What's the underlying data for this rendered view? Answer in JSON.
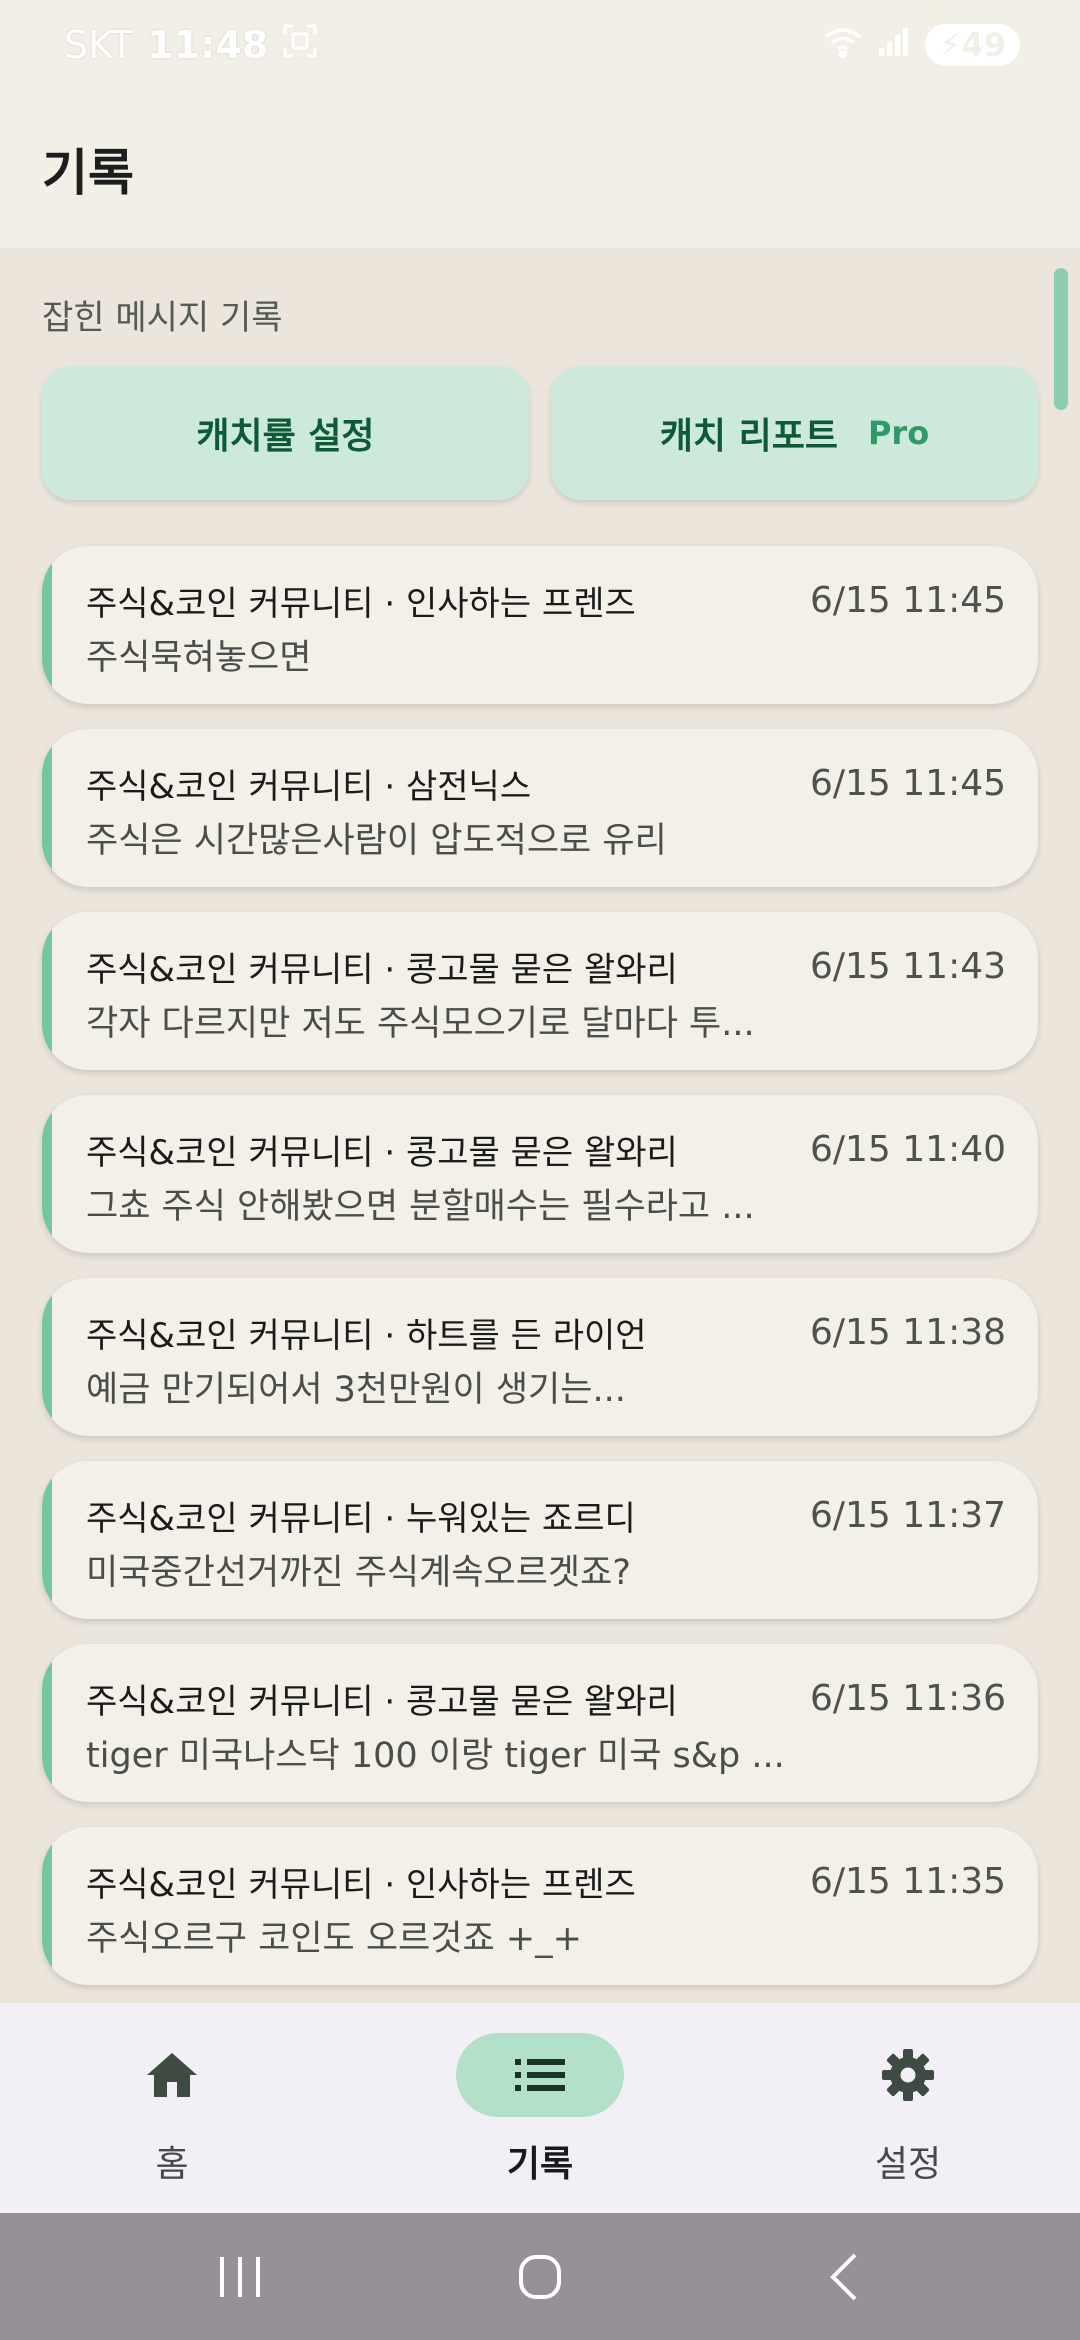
{
  "status_bar": {
    "carrier": "SKT",
    "time": "11:48",
    "battery": "49"
  },
  "app_bar": {
    "title": "기록"
  },
  "section": {
    "label": "잡힌 메시지 기록"
  },
  "buttons": {
    "catch_rate_label": "캐치률 설정",
    "catch_report_label": "캐치 리포트",
    "pro_badge": "Pro"
  },
  "records": [
    {
      "title": "주식&코인 커뮤니티 · 인사하는 프렌즈",
      "time": "6/15 11:45",
      "message": "주식묵혀놓으면"
    },
    {
      "title": "주식&코인 커뮤니티 · 삼전닉스",
      "time": "6/15 11:45",
      "message": "주식은 시간많은사람이 압도적으로 유리"
    },
    {
      "title": "주식&코인 커뮤니티 · 콩고물 묻은 왈와리",
      "time": "6/15 11:43",
      "message": "각자 다르지만 저도 주식모으기로 달마다 투..."
    },
    {
      "title": "주식&코인 커뮤니티 · 콩고물 묻은 왈와리",
      "time": "6/15 11:40",
      "message": "그쵸 주식 안해봤으면 분할매수는 필수라고 ..."
    },
    {
      "title": "주식&코인 커뮤니티 · 하트를 든 라이언",
      "time": "6/15 11:38",
      "message": "예금 만기되어서 3천만원이 생기는..."
    },
    {
      "title": "주식&코인 커뮤니티 · 누워있는 죠르디",
      "time": "6/15 11:37",
      "message": "미국중간선거까진 주식계속오르겟죠?"
    },
    {
      "title": "주식&코인 커뮤니티 · 콩고물 묻은 왈와리",
      "time": "6/15 11:36",
      "message": "tiger 미국나스닥 100 이랑 tiger 미국 s&p ..."
    },
    {
      "title": "주식&코인 커뮤니티 · 인사하는 프렌즈",
      "time": "6/15 11:35",
      "message": "주식오르구 코인도 오르것죠 +_+"
    }
  ],
  "bottom_nav": {
    "home_label": "홈",
    "records_label": "기록",
    "settings_label": "설정",
    "active": "records"
  },
  "colors": {
    "accent": "#72c79d",
    "button_bg": "#cde9dc",
    "button_text": "#0f5a36",
    "active_nav_bg": "#b3e0c8"
  },
  "icons": {
    "home": "home-icon",
    "records": "list-icon",
    "settings": "gear-icon"
  }
}
